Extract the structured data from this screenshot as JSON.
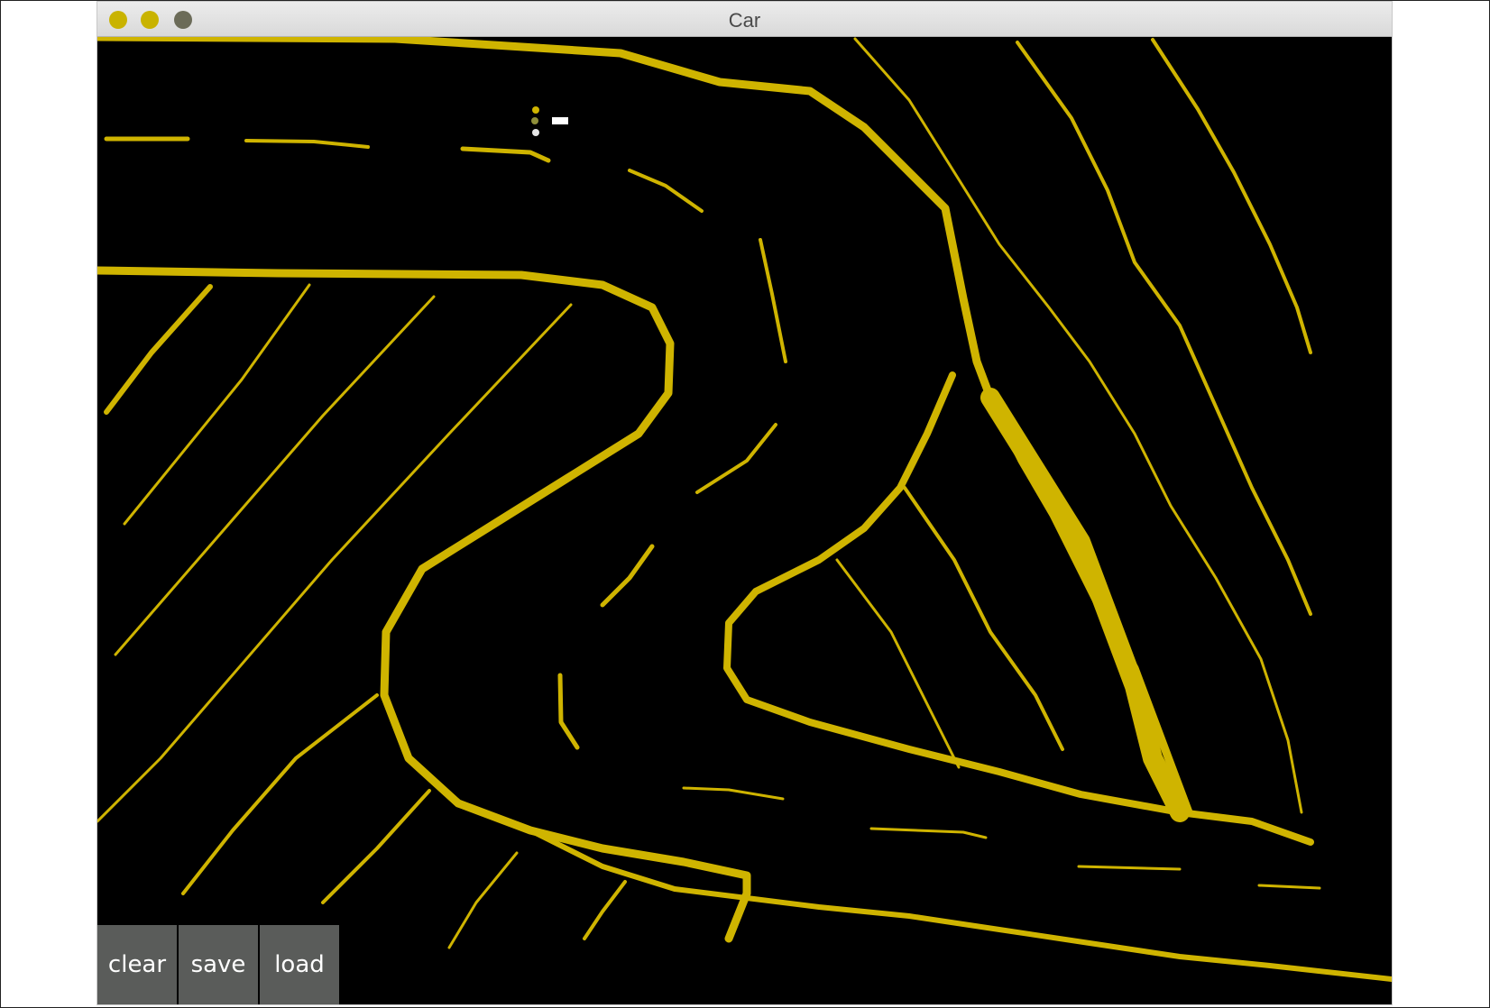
{
  "window": {
    "title": "Car",
    "traffic_lights": [
      {
        "name": "close",
        "color": "#c9b300"
      },
      {
        "name": "minimize",
        "color": "#c9b300"
      },
      {
        "name": "maximize",
        "color": "#6b6b58"
      }
    ]
  },
  "canvas": {
    "background": "#000000",
    "sand_color": "#cfb400",
    "car": {
      "body_color": "#ffffff",
      "sensor_colors": [
        "#cfb400",
        "#8f8f3a",
        "#e6e6e6"
      ]
    }
  },
  "toolbar": {
    "clear_label": "clear",
    "save_label": "save",
    "load_label": "load",
    "button_color": "#5a5c5a"
  }
}
